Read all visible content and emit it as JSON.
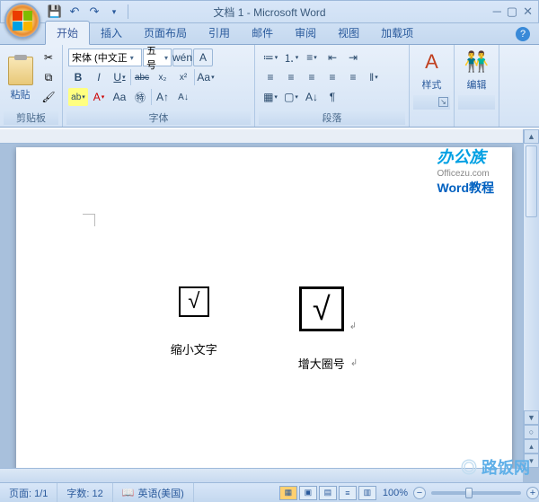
{
  "title": "文档 1 - Microsoft Word",
  "tabs": [
    "开始",
    "插入",
    "页面布局",
    "引用",
    "邮件",
    "审阅",
    "视图",
    "加载项"
  ],
  "clipboard": {
    "paste": "粘贴",
    "label": "剪贴板"
  },
  "font": {
    "name": "宋体 (中文正",
    "size": "五号",
    "label": "字体",
    "bold": "B",
    "italic": "I",
    "underline": "U",
    "strike": "abc",
    "sub": "x₂",
    "sup": "x²",
    "highlight": "ab",
    "fontcolor": "A",
    "clearfmt": "Aa",
    "phonetic": "拼",
    "charborder": "A",
    "grow": "A▴",
    "shrink": "A▾",
    "case": "Aa▾",
    "enclose": "㊕"
  },
  "para": {
    "label": "段落"
  },
  "styles": {
    "label": "样式",
    "icon": "A"
  },
  "edit": {
    "label": "编辑",
    "icon": "🔍"
  },
  "watermark": {
    "l1": "办公族",
    "l2": "Officezu.com",
    "l3": "Word教程"
  },
  "doc": {
    "label_small": "缩小文字",
    "label_large": "增大圈号",
    "check": "√"
  },
  "status": {
    "page": "页面: 1/1",
    "words": "字数: 12",
    "lang": "英语(美国)",
    "zoom": "100%"
  },
  "footer_wm": "路饭网"
}
